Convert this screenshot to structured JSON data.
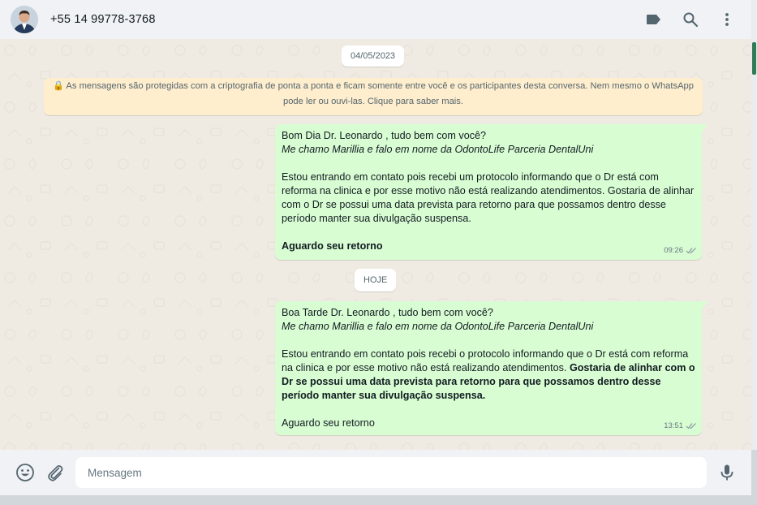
{
  "header": {
    "contact_name": "+55 14 99778-3768",
    "icons": [
      "label-icon",
      "search-icon",
      "menu-icon"
    ]
  },
  "chat": {
    "date_chip_1": "04/05/2023",
    "encryption_notice_line1": "🔒 As mensagens são protegidas com a criptografia de ponta a ponta e ficam somente entre você e os participantes desta conversa. Nem mesmo o WhatsApp",
    "encryption_notice_line2": "pode ler ou ouvi-las. Clique para saber mais.",
    "messages": [
      {
        "greeting": "Bom Dia Dr. Leonardo , tudo bem com você?",
        "intro": "Me chamo Marillia e falo em nome da OdontoLife Parceria DentalUni",
        "body": "Estou entrando em contato pois recebi um protocolo informando que o Dr está com reforma na clinica e por esse motivo não está realizando atendimentos. Gostaria de alinhar com o Dr se possui uma data prevista para retorno para que possamos dentro desse período manter sua divulgação suspensa.",
        "closing": "Aguardo seu retorno",
        "time": "09:26"
      },
      {
        "greeting": "Boa Tarde Dr. Leonardo , tudo bem com você?",
        "intro": "Me chamo Marillia e falo em nome da OdontoLife Parceria DentalUni",
        "body_plain": "Estou entrando em contato pois recebi o protocolo informando que o Dr está com reforma na clinica e por esse motivo não está realizando atendimentos. ",
        "body_bold": "Gostaria de alinhar com o Dr se possui uma data prevista para retorno para que possamos dentro desse período manter sua divulgação suspensa.",
        "closing": "Aguardo seu retorno",
        "time": "13:51"
      }
    ],
    "date_chip_2": "HOJE"
  },
  "footer": {
    "placeholder": "Mensagem",
    "icons": [
      "emoji-icon",
      "attach-icon",
      "microphone-icon"
    ]
  },
  "colors": {
    "outgoing_bubble": "#d9fdd3",
    "chat_background": "#efeae2",
    "notice_background": "#ffeecd",
    "header_background": "#f0f2f5",
    "read_ticks": "#8696a0"
  }
}
